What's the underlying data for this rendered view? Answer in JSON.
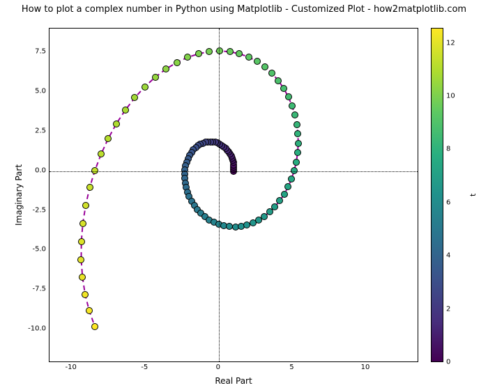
{
  "chart_data": {
    "type": "scatter",
    "title": "How to plot a complex number in Python using Matplotlib - Customized Plot - how2matplotlib.com",
    "xlabel": "Real Part",
    "ylabel": "Imaginary Part",
    "colorbar_label": "t",
    "xlim": [
      -11.5,
      13.6
    ],
    "ylim": [
      -12.1,
      9.0
    ],
    "xticks": [
      -10,
      -5,
      0,
      5,
      10
    ],
    "yticks": [
      -10.0,
      -7.5,
      -5.0,
      -2.5,
      0.0,
      2.5,
      5.0,
      7.5
    ],
    "cticks": [
      0,
      2,
      4,
      6,
      8,
      10,
      12
    ],
    "clim": [
      0,
      12.566
    ],
    "curve": "z(t) = exp((0.2 + i) * t),  t in [0, 4*pi]",
    "n_points": 100,
    "curve_style": {
      "color": "purple",
      "linestyle": "dashed"
    },
    "marker_colormap": "viridis",
    "t": [
      0,
      0.127,
      0.254,
      0.381,
      0.508,
      0.634,
      0.761,
      0.888,
      1.015,
      1.142,
      1.269,
      1.396,
      1.523,
      1.65,
      1.777,
      1.904,
      2.031,
      2.158,
      2.284,
      2.411,
      2.538,
      2.665,
      2.792,
      2.919,
      3.046,
      3.173,
      3.3,
      3.427,
      3.554,
      3.681,
      3.808,
      3.934,
      4.061,
      4.188,
      4.315,
      4.442,
      4.569,
      4.696,
      4.823,
      4.95,
      5.077,
      5.204,
      5.331,
      5.458,
      5.584,
      5.711,
      5.838,
      5.965,
      6.092,
      6.219,
      6.346,
      6.473,
      6.6,
      6.727,
      6.854,
      6.981,
      7.108,
      7.234,
      7.361,
      7.488,
      7.615,
      7.742,
      7.869,
      7.996,
      8.123,
      8.25,
      8.377,
      8.504,
      8.631,
      8.758,
      8.884,
      9.011,
      9.138,
      9.265,
      9.392,
      9.519,
      9.646,
      9.773,
      9.9,
      10.027,
      10.154,
      10.281,
      10.408,
      10.534,
      10.661,
      10.788,
      10.915,
      11.042,
      11.169,
      11.296,
      11.423,
      11.55,
      11.677,
      11.804,
      11.931,
      12.058,
      12.184,
      12.311,
      12.438,
      12.566
    ],
    "x": [
      1.0,
      1.017,
      1.021,
      1.013,
      0.992,
      0.958,
      0.91,
      0.849,
      0.775,
      0.688,
      0.588,
      0.476,
      0.353,
      0.22,
      0.077,
      -0.074,
      -0.233,
      -0.397,
      -0.566,
      -0.738,
      -0.911,
      -1.083,
      -1.252,
      -1.417,
      -1.574,
      -1.722,
      -1.859,
      -1.982,
      -2.089,
      -2.178,
      -2.246,
      -2.292,
      -2.314,
      -2.31,
      -2.278,
      -2.217,
      -2.127,
      -2.006,
      -1.855,
      -1.673,
      -1.461,
      -1.22,
      -0.951,
      -0.656,
      -0.337,
      0.003,
      0.362,
      0.737,
      1.124,
      1.518,
      1.917,
      2.316,
      2.71,
      3.095,
      3.465,
      3.817,
      4.145,
      4.444,
      4.71,
      4.939,
      5.125,
      5.266,
      5.357,
      5.396,
      5.379,
      5.305,
      5.172,
      4.979,
      4.726,
      4.413,
      4.042,
      3.614,
      3.133,
      2.601,
      2.023,
      1.404,
      0.748,
      0.063,
      -0.648,
      -1.376,
      -2.114,
      -2.856,
      -3.595,
      -4.322,
      -5.029,
      -5.708,
      -6.352,
      -6.952,
      -7.502,
      -7.992,
      -8.417,
      -8.77,
      -9.044,
      -9.235,
      -9.337,
      -9.346,
      -9.261,
      -9.079,
      -8.8,
      -8.424
    ],
    "y": [
      0.0,
      0.13,
      0.264,
      0.401,
      0.539,
      0.678,
      0.816,
      0.951,
      1.083,
      1.209,
      1.329,
      1.44,
      1.541,
      1.631,
      1.707,
      1.77,
      1.816,
      1.845,
      1.856,
      1.847,
      1.818,
      1.767,
      1.695,
      1.6,
      1.483,
      1.344,
      1.183,
      1.001,
      0.799,
      0.578,
      0.34,
      0.087,
      -0.179,
      -0.455,
      -0.739,
      -1.028,
      -1.318,
      -1.606,
      -1.888,
      -2.159,
      -2.417,
      -2.657,
      -2.875,
      -3.067,
      -3.229,
      -3.358,
      -3.45,
      -3.502,
      -3.511,
      -3.475,
      -3.392,
      -3.26,
      -3.078,
      -2.847,
      -2.567,
      -2.238,
      -1.864,
      -1.447,
      -0.989,
      -0.496,
      0.029,
      0.581,
      1.154,
      1.743,
      2.341,
      2.942,
      3.538,
      4.121,
      4.684,
      5.219,
      5.718,
      6.173,
      6.577,
      6.922,
      7.201,
      7.408,
      7.537,
      7.583,
      7.541,
      7.407,
      7.18,
      6.858,
      6.44,
      5.928,
      5.324,
      4.631,
      3.854,
      2.999,
      2.073,
      1.085,
      0.043,
      -1.041,
      -2.157,
      -3.293,
      -4.436,
      -5.574,
      -6.693,
      -7.779,
      -8.818,
      -9.797
    ],
    "grid_at_zero": true
  }
}
